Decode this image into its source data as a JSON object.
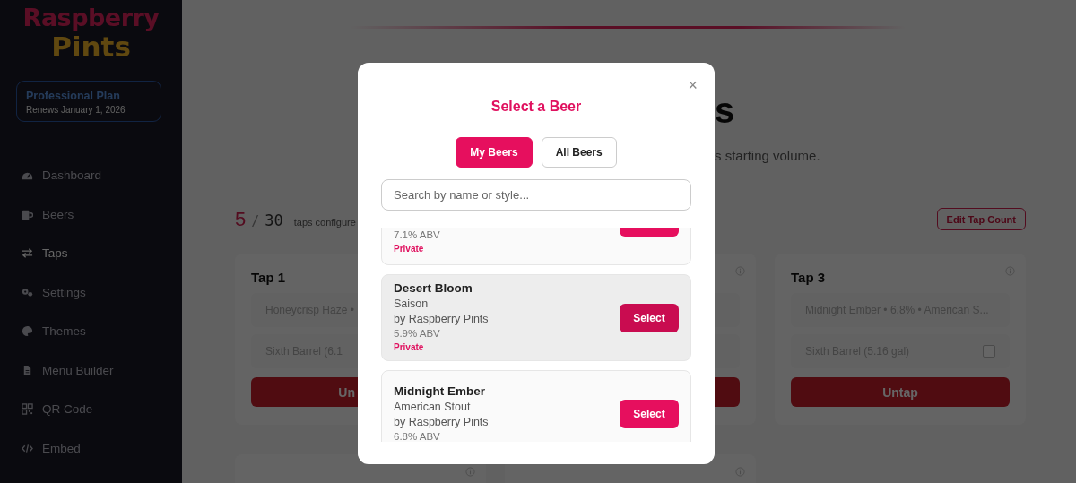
{
  "sidebar": {
    "logo": {
      "line_1": "Raspberry",
      "line_2": "Pints"
    },
    "plan": {
      "name": "Professional Plan",
      "renewal": "Renews January 1, 2026"
    },
    "items": [
      {
        "label": "Dashboard",
        "selected": false
      },
      {
        "label": "Beers",
        "selected": false
      },
      {
        "label": "Taps",
        "selected": true
      },
      {
        "label": "Settings",
        "selected": false
      },
      {
        "label": "Themes",
        "selected": false
      },
      {
        "label": "Menu Builder",
        "selected": false
      },
      {
        "label": "QR Code",
        "selected": false
      },
      {
        "label": "Embed",
        "selected": false
      }
    ]
  },
  "page": {
    "heading": "s",
    "subtitle": "s starting volume.",
    "count": {
      "configured": "5",
      "separator": "/",
      "total": "30",
      "label": "taps configure"
    },
    "edit_button": "Edit Tap Count",
    "taps": [
      {
        "kind": "cut",
        "title": "Tap 1",
        "fields": [
          {
            "text": "Honeycrisp Haze •"
          },
          {
            "text": "Sixth Barrel (6.1"
          }
        ],
        "button": "Un"
      },
      {
        "kind": "hidden"
      },
      {
        "kind": "full",
        "title": "Tap 3",
        "fields": [
          {
            "text": "Midnight Ember • 6.8% • American S..."
          },
          {
            "text": "Sixth Barrel (5.16 gal)",
            "checked": false
          }
        ],
        "button": "Untap"
      }
    ],
    "next_row": [
      {
        "kind": "cut"
      },
      {
        "kind": "cut"
      }
    ]
  },
  "modal": {
    "close": "×",
    "title": "Select a Beer",
    "tabs": [
      {
        "label": "My Beers",
        "selected": true
      },
      {
        "label": "All Beers",
        "selected": false
      }
    ],
    "search": {
      "placeholder": "Search by name or style..."
    },
    "beers": [
      {
        "abv": "7.1% ABV",
        "visibility": "Private",
        "highlighted": false
      },
      {
        "name": "Desert Bloom",
        "style": "Saison",
        "brewer": "by Raspberry Pints",
        "abv": "5.9% ABV",
        "visibility": "Private",
        "button": "Select",
        "highlighted": true
      },
      {
        "name": "Midnight Ember",
        "style": "American Stout",
        "brewer": "by Raspberry Pints",
        "abv": "6.8% ABV",
        "button": "Select",
        "highlighted": false
      }
    ]
  }
}
